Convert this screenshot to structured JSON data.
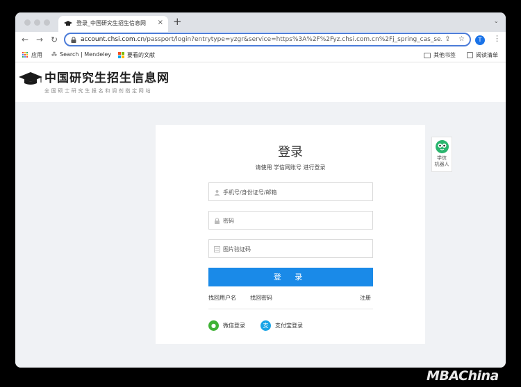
{
  "browser": {
    "tab": {
      "title": "登录_中国研究生招生信息网",
      "close": "×"
    },
    "new_tab": "+",
    "tab_menu": "⌄",
    "url_host": "account.chsi.com.cn",
    "url_path": "/passport/login?entrytype=yzgr&service=https%3A%2F%2Fyz.chsi.com.cn%2Fj_spring_cas_se...",
    "profile_initial": "T",
    "bookmarks": [
      {
        "label": "应用"
      },
      {
        "label": "Search | Mendeley"
      },
      {
        "label": "要看的文献"
      }
    ],
    "bookmarks_right": [
      {
        "label": "其他书签"
      },
      {
        "label": "阅读清单"
      }
    ]
  },
  "site": {
    "title": "中国研究生招生信息网",
    "subtitle": "全国硕士研究生报名和调剂指定网站"
  },
  "login": {
    "title": "登录",
    "subtitle": "请使用 学信网账号 进行登录",
    "username_placeholder": "手机号/身份证号/邮箱",
    "password_placeholder": "密码",
    "captcha_placeholder": "图片验证码",
    "button": "登 录",
    "find_username": "找回用户名",
    "find_password": "找回密码",
    "register": "注册",
    "wechat": "微信登录",
    "alipay": "支付宝登录",
    "alipay_glyph": "支"
  },
  "robot": {
    "label_line1": "学信",
    "label_line2": "机器人"
  },
  "watermark": "MBAChina",
  "colors": {
    "accent": "#1a8ae8",
    "omnibox_border": "#4b7bd8",
    "wechat": "#3fb235",
    "alipay": "#1ba4e6"
  }
}
